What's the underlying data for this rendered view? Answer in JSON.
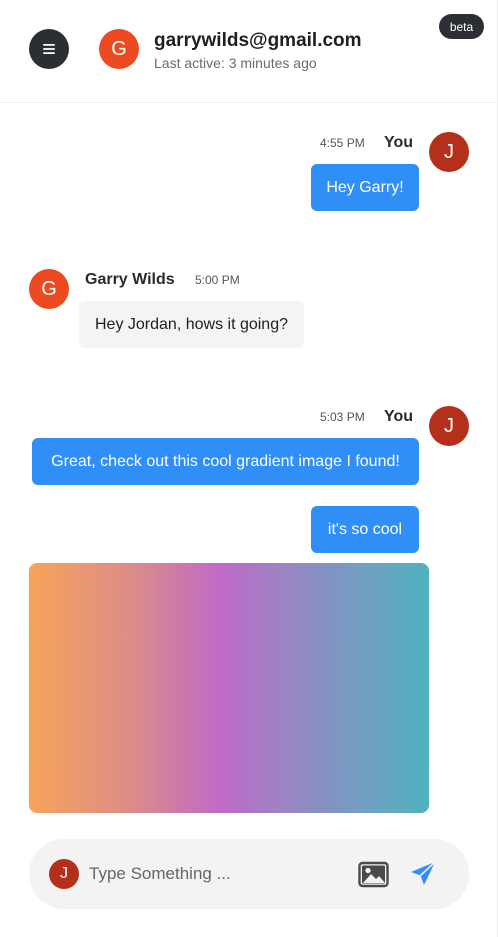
{
  "header": {
    "avatar_letter": "G",
    "contact_email": "garrywilds@gmail.com",
    "last_active": "Last active: 3 minutes ago",
    "beta_label": "beta"
  },
  "messages": [
    {
      "time": "4:55 PM",
      "sender": "You",
      "avatar_letter": "J",
      "text": "Hey Garry!"
    },
    {
      "time": "5:00 PM",
      "sender": "Garry Wilds",
      "avatar_letter": "G",
      "text": "Hey Jordan, hows it going?"
    },
    {
      "time": "5:03 PM",
      "sender": "You",
      "avatar_letter": "J",
      "text": "Great, check out this cool gradient image I found!",
      "text2": "it's so cool"
    }
  ],
  "composer": {
    "avatar_letter": "J",
    "placeholder": "Type Something ..."
  },
  "colors": {
    "accent": "#2f8ff7",
    "dark": "#2b2f33",
    "avatar_g": "#ee4a22",
    "avatar_j": "#b5301a"
  },
  "icons": [
    "menu-icon",
    "image-icon",
    "send-icon"
  ]
}
